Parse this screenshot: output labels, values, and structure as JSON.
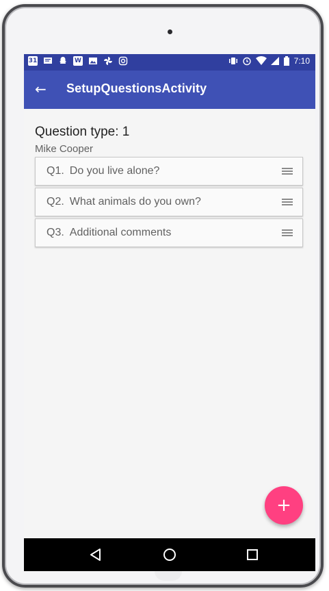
{
  "status_bar": {
    "left_icons": [
      "calendar-31-icon",
      "message-icon",
      "snapchat-icon",
      "word-icon",
      "photos-icon",
      "pinwheel-icon",
      "instagram-icon"
    ],
    "calendar_label": "31",
    "word_label": "W",
    "right_icons": [
      "vibrate-icon",
      "alarm-icon",
      "wifi-icon",
      "signal-icon",
      "battery-icon"
    ],
    "time": "7:10"
  },
  "app_bar": {
    "title": "SetupQuestionsActivity",
    "back_glyph": "←"
  },
  "header": {
    "question_type": "Question type: 1",
    "author": "Mike Cooper"
  },
  "questions": [
    {
      "number": "Q1.",
      "text": "Do you live alone?"
    },
    {
      "number": "Q2.",
      "text": "What animals do you own?"
    },
    {
      "number": "Q3.",
      "text": "Additional comments"
    }
  ],
  "fab": {
    "glyph": "+"
  },
  "colors": {
    "status_bar": "#303f9f",
    "app_bar": "#3f51b5",
    "fab": "#ff4081",
    "nav_bar": "#000000"
  }
}
